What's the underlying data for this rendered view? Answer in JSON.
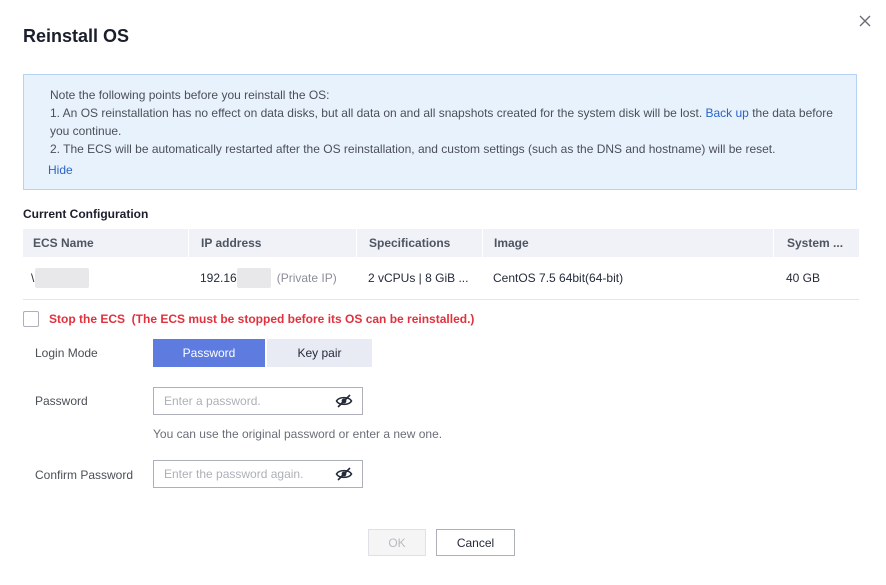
{
  "dialog": {
    "title": "Reinstall OS",
    "close_icon": "close-icon"
  },
  "notice": {
    "line1": "Note the following points before you reinstall the OS:",
    "line2_pre": "1. An OS reinstallation has no effect on data disks, but all data on and all snapshots created for the system disk will be lost.",
    "line2_link": "Back up",
    "line2_post": "the data before",
    "line3": "you continue.",
    "line4": "2. The ECS will be automatically restarted after the OS reinstallation, and custom settings (such as the DNS and hostname) will be reset.",
    "hide_link": "Hide"
  },
  "current_config": {
    "title": "Current Configuration",
    "headers": [
      "ECS Name",
      "IP address",
      "Specifications",
      "Image",
      "System ..."
    ],
    "row": {
      "ecs_name": "\\",
      "ip": "192.16",
      "ip_note": "(Private IP)",
      "specs": "2 vCPUs | 8 GiB ...",
      "image": "CentOS 7.5 64bit(64-bit)",
      "system_disk": "40 GB"
    }
  },
  "stop_ecs": {
    "label": "Stop the ECS  (The ECS must be stopped before its OS can be reinstalled.)",
    "checked": false
  },
  "login_mode": {
    "label": "Login Mode",
    "options": [
      "Password",
      "Key pair"
    ],
    "selected": "Password"
  },
  "password": {
    "label": "Password",
    "placeholder": "Enter a password.",
    "hint": "You can use the original password or enter a new one.",
    "icon": "eye-off-icon"
  },
  "confirm_password": {
    "label": "Confirm Password",
    "placeholder": "Enter the password again.",
    "icon": "eye-off-icon"
  },
  "footer": {
    "ok_label": "OK",
    "cancel_label": "Cancel"
  },
  "colors": {
    "primary": "#5e7ce0",
    "link": "#2b63c6",
    "danger": "#e0323e",
    "notice_bg": "#e8f2fd"
  }
}
